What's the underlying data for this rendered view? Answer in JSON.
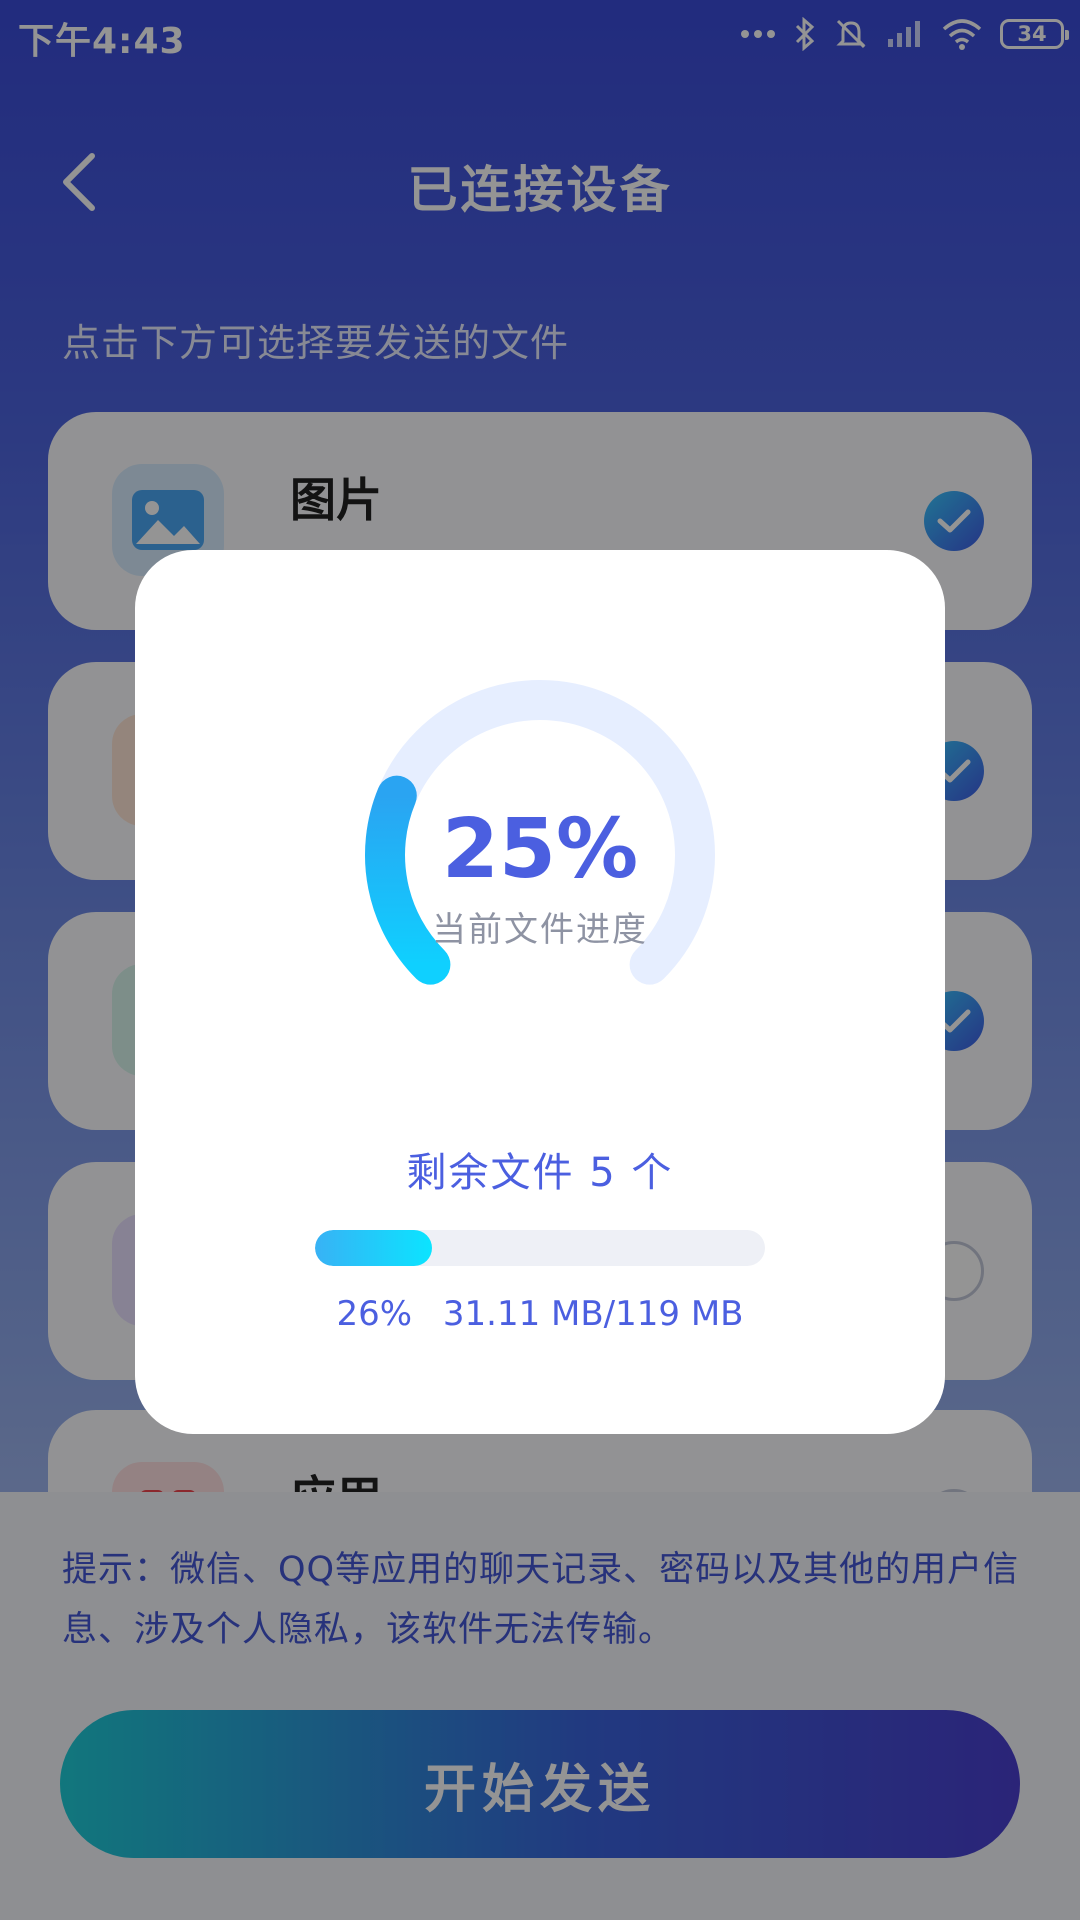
{
  "status_bar": {
    "time": "下午4:43",
    "battery": "34"
  },
  "header": {
    "title": "已连接设备"
  },
  "instruction": "点击下方可选择要发送的文件",
  "categories": [
    {
      "label": "图片",
      "checked": true,
      "icon": "image-icon",
      "color": "#4aa8f5"
    },
    {
      "label": "",
      "checked": true,
      "icon": "video-icon",
      "color": "#ff8a3d"
    },
    {
      "label": "",
      "checked": true,
      "icon": "music-icon",
      "color": "#35c9a5"
    },
    {
      "label": "",
      "checked": false,
      "icon": "document-icon",
      "color": "#8a63e6"
    },
    {
      "label": "应用",
      "checked": false,
      "icon": "app-icon",
      "color": "#f0464f"
    }
  ],
  "tip": "提示：微信、QQ等应用的聊天记录、密码以及其他的用户信息、涉及个人隐私，该软件无法传输。",
  "send_button": "开始发送",
  "dialog": {
    "current_progress": "25%",
    "current_progress_value": 0.25,
    "current_label": "当前文件进度",
    "remaining_text": "剩余文件 5 个",
    "total_progress_value": 0.26,
    "total_percent": "26%",
    "total_size": "31.11 MB/119 MB"
  },
  "colors": {
    "accent": "#4b5fe0",
    "gauge_fill": "#1aa9f5",
    "gauge_track": "#e6eeff"
  }
}
